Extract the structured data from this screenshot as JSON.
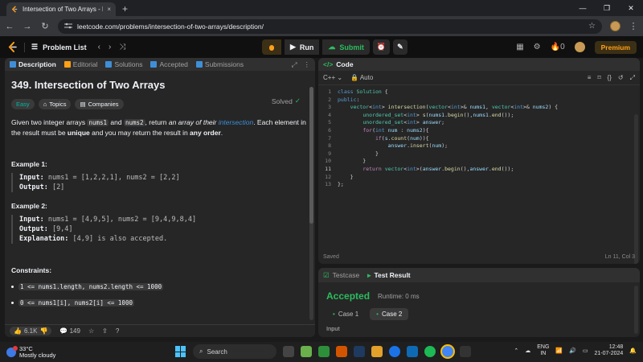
{
  "browser": {
    "tab_title": "Intersection of Two Arrays - Lee",
    "url": "leetcode.com/problems/intersection-of-two-arrays/description/",
    "close_glyph": "×",
    "newtab_glyph": "+",
    "win_controls": [
      "—",
      "❐",
      "✕"
    ]
  },
  "nav": {
    "problem_list": "Problem List",
    "run": "Run",
    "submit": "Submit",
    "streak": "0",
    "premium": "Premium"
  },
  "left_tabs": [
    "Description",
    "Editorial",
    "Solutions",
    "Accepted",
    "Submissions"
  ],
  "problem": {
    "title": "349. Intersection of Two Arrays",
    "solved": "Solved",
    "tags": [
      "Easy",
      "Topics",
      "Companies"
    ],
    "desc_parts": {
      "p1": "Given two integer arrays ",
      "c1": "nums1",
      "p2": " and ",
      "c2": "nums2",
      "p3": ", return ",
      "em1": "an array of their ",
      "link": "intersection",
      "p4": ". Each element in the result must be ",
      "b1": "unique",
      "p5": " and you may return the result in ",
      "b2": "any order",
      "p6": "."
    },
    "example1": {
      "heading": "Example 1:",
      "input_label": "Input:",
      "input": " nums1 = [1,2,2,1], nums2 = [2,2]",
      "output_label": "Output:",
      "output": " [2]"
    },
    "example2": {
      "heading": "Example 2:",
      "input_label": "Input:",
      "input": " nums1 = [4,9,5], nums2 = [9,4,9,8,4]",
      "output_label": "Output:",
      "output": " [9,4]",
      "expl_label": "Explanation:",
      "expl": " [4,9] is also accepted."
    },
    "constraints_heading": "Constraints:",
    "constraints": [
      "1 <= nums1.length, nums2.length <= 1000",
      "0 <= nums1[i], nums2[i] <= 1000"
    ]
  },
  "left_footer": {
    "likes": "6.1K",
    "comments": "149"
  },
  "code": {
    "heading": "Code",
    "language": "C++",
    "auto": "Auto",
    "line_numbers": [
      "1",
      "2",
      "3",
      "4",
      "5",
      "6",
      "7",
      "8",
      "9",
      "10",
      "11",
      "12",
      "13"
    ],
    "saved": "Saved",
    "cursor": "Ln 11, Col 3"
  },
  "test": {
    "tab_testcase": "Testcase",
    "tab_result": "Test Result",
    "status": "Accepted",
    "runtime": "Runtime: 0 ms",
    "cases": [
      "Case 1",
      "Case 2"
    ],
    "input_label": "Input"
  },
  "taskbar": {
    "temp": "33°C",
    "weather": "Mostly cloudy",
    "search": "Search",
    "lang1": "ENG",
    "lang2": "IN",
    "time": "12:48",
    "date": "21-07-2024"
  },
  "colors": {
    "accent_orange": "#ffa116",
    "accepted_green": "#2cbb5d",
    "link_blue": "#3e8ed8"
  }
}
